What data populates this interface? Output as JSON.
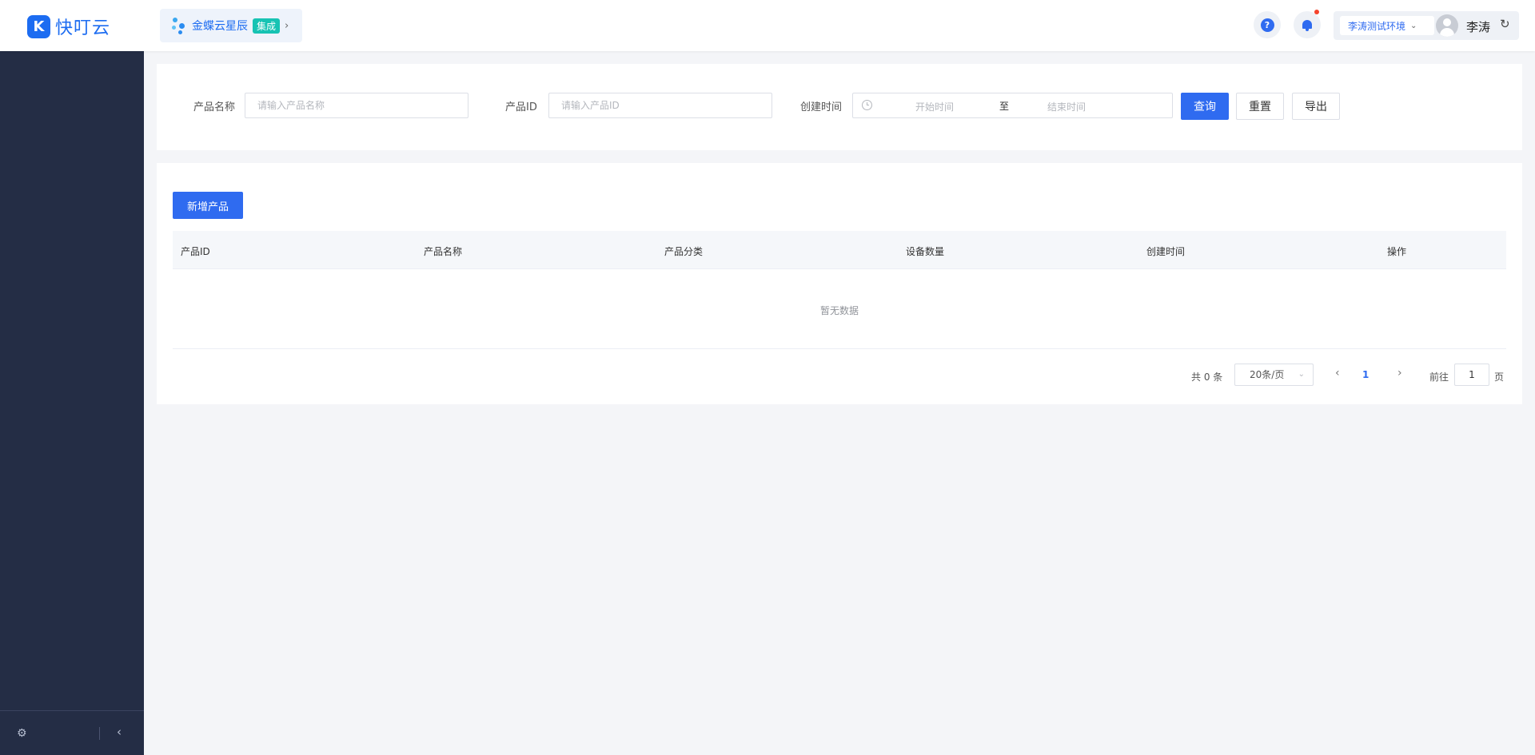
{
  "header": {
    "logo_mark": "K",
    "logo_text": "快叮云",
    "app_switch": {
      "name": "金蝶云星辰",
      "badge": "集成",
      "chevron": "›"
    },
    "help_icon": "?",
    "environment": {
      "label": "李涛测试环境",
      "chevron": "⌄"
    },
    "user_name": "李涛",
    "refresh_icon": "↻"
  },
  "sidebar": {
    "footer": {
      "gear_icon": "⚙",
      "collapse_icon": "‹"
    }
  },
  "search": {
    "product_name": {
      "label": "产品名称",
      "placeholder": "请输入产品名称"
    },
    "product_id": {
      "label": "产品ID",
      "placeholder": "请输入产品ID"
    },
    "created_time": {
      "label": "创建时间",
      "start_placeholder": "开始时间",
      "separator": "至",
      "end_placeholder": "结束时间"
    },
    "query_label": "查询",
    "reset_label": "重置",
    "export_label": "导出"
  },
  "table": {
    "add_label": "新增产品",
    "columns": [
      "产品ID",
      "产品名称",
      "产品分类",
      "设备数量",
      "创建时间",
      "操作"
    ],
    "empty_text": "暂无数据"
  },
  "pagination": {
    "total_text": "共 0 条",
    "page_size": "20条/页",
    "prev_icon": "‹",
    "current_page": "1",
    "next_icon": "›",
    "goto_label": "前往",
    "goto_value": "1",
    "goto_unit": "页"
  },
  "colors": {
    "primary": "#2f6bf0",
    "sidebar": "#242d45",
    "badge": "#17c3b3",
    "notification_dot": "#f5432c"
  }
}
